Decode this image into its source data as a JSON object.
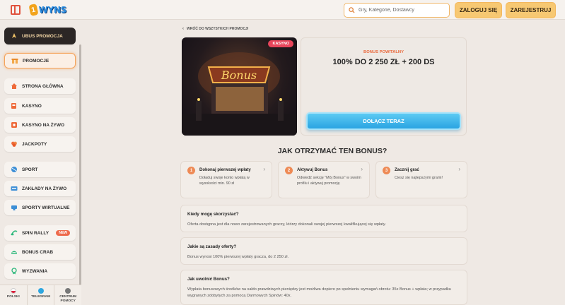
{
  "header": {
    "logo_text": "WYNS",
    "logo_badge": "1",
    "search_placeholder": "Gry, Kategorie, Dostawcy",
    "login_label": "ZALOGUJ SIĘ",
    "register_label": "ZAREJESTRUJ"
  },
  "sidebar": {
    "promo_bonus": "UBUS PROMOCJA",
    "promocje": "PROMOCJE",
    "items": [
      {
        "label": "STRONA GŁÓWNA",
        "icon": "home-icon"
      },
      {
        "label": "KASYNO",
        "icon": "slot-icon"
      },
      {
        "label": "KASYNO NA ŻYWO",
        "icon": "live-casino-icon"
      },
      {
        "label": "JACKPOTY",
        "icon": "jackpot-icon"
      },
      {
        "label": "SPORT",
        "icon": "sport-icon"
      },
      {
        "label": "ZAKŁADY NA ŻYWO",
        "icon": "live-bet-icon"
      },
      {
        "label": "SPORTY WIRTUALNE",
        "icon": "virtual-sport-icon"
      },
      {
        "label": "SPIN RALLY",
        "icon": "spin-rally-icon"
      },
      {
        "label": "BONUS CRAB",
        "icon": "bonus-crab-icon"
      },
      {
        "label": "WYZWANIA",
        "icon": "challenge-icon"
      }
    ],
    "new_badge": "NEW",
    "bottom": {
      "language": "POLSKI",
      "telegram": "TELEGRAM",
      "help_line1": "CENTRUM",
      "help_line2": "POMOCY"
    }
  },
  "main": {
    "back_link": "WRÓĆ DO WSZYSTKICH PROMOCJI",
    "badge": "KASYNO",
    "bonus_label": "BONUS POWITALNY",
    "bonus_title": "100% DO 2 250 ZŁ + 200 DS",
    "join_label": "DOŁĄCZ TERAZ",
    "section_title": "JAK OTRZYMAĆ TEN BONUS?",
    "steps": [
      {
        "num": "1",
        "title": "Dokonaj pierwszej wpłaty",
        "desc": "Doładuj swoje konto wpłatą w wysokości min. 90 zł"
      },
      {
        "num": "2",
        "title": "Aktywuj Bonus",
        "desc": "Odwiedź sekcję \"Mój Bonus\" w swoim profilu i aktywuj promocję"
      },
      {
        "num": "3",
        "title": "Zacznij grać",
        "desc": "Ciesz się najlepszymi grami!"
      }
    ],
    "faq": [
      {
        "q": "Kiedy mogę skorzystać?",
        "a": "Oferta dostępna jest dla nowo zarejestrowanych graczy, którzy dokonali swojej pierwszej kwalifikującej się wpłaty."
      },
      {
        "q": "Jakie są zasady oferty?",
        "a": "Bonus wynosi 100% pierwszej wpłaty gracza, do 2 250 zł."
      },
      {
        "q": "Jak uwolnić Bonus?",
        "a": "Wypłata bonusowych środków na saldo prawdziwych pieniędzy jest możliwa dopiero po spełnieniu wymagań obrotu: 35x Bonus + wpłata; w przypadku wygranych zdobytych za pomocą Darmowych Spinów: 40x."
      }
    ]
  },
  "colors": {
    "accent_orange": "#ee8a55",
    "join_blue": "#2aa4e2",
    "login_yellow": "#f7c872",
    "badge_red": "#e8455b"
  }
}
